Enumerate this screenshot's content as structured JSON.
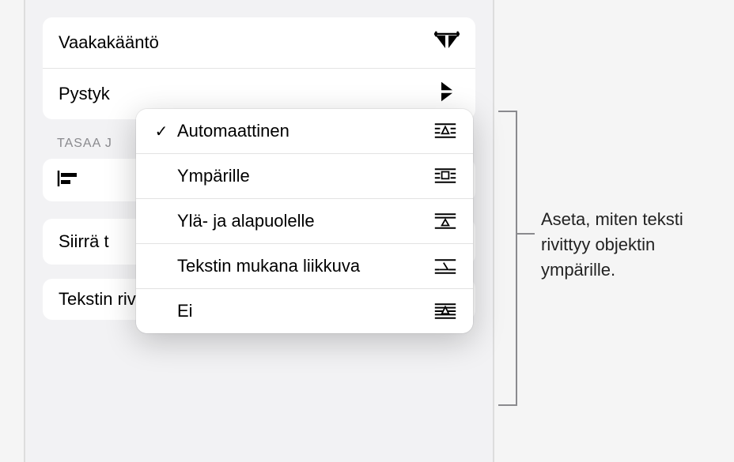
{
  "panel": {
    "flip_horizontal_label": "Vaakakääntö",
    "flip_vertical_label": "Pystykääntö",
    "flip_vertical_truncated": "Pystyk",
    "align_section_label": "TASAA J",
    "move_text_label": "Siirrä t",
    "text_wrap_label": "Tekstin rivitys",
    "text_wrap_value": "Automaattinen"
  },
  "popup": {
    "items": [
      {
        "label": "Automaattinen",
        "checked": true
      },
      {
        "label": "Ympärille",
        "checked": false
      },
      {
        "label": "Ylä- ja alapuolelle",
        "checked": false
      },
      {
        "label": "Tekstin mukana liikkuva",
        "checked": false
      },
      {
        "label": "Ei",
        "checked": false
      }
    ]
  },
  "callout": {
    "text": "Aseta, miten teksti rivittyy objektin ympärille."
  }
}
